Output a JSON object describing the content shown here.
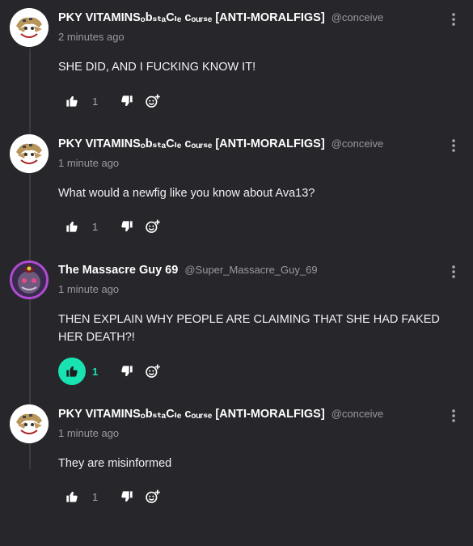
{
  "comments": [
    {
      "username": "PKY VITAMINSₒbₛₜₐCₗₑ cₒᵤᵣₛₑ [ANTI-MORALFIGS]",
      "handle": "@conceive",
      "time": "2 minutes ago",
      "text": "SHE DID, AND I FUCKING KNOW IT!",
      "likes": "1",
      "liked": false
    },
    {
      "username": "PKY VITAMINSₒbₛₜₐCₗₑ cₒᵤᵣₛₑ [ANTI-MORALFIGS]",
      "handle": "@conceive",
      "time": "1 minute ago",
      "text": "What would a newfig like you know about Ava13?",
      "likes": "1",
      "liked": false
    },
    {
      "username": "The Massacre Guy 69",
      "handle": "@Super_Massacre_Guy_69",
      "time": "1 minute ago",
      "text": "THEN EXPLAIN WHY PEOPLE ARE CLAIMING THAT SHE HAD FAKED HER DEATH?!",
      "likes": "1",
      "liked": true
    },
    {
      "username": "PKY VITAMINSₒbₛₜₐCₗₑ cₒᵤᵣₛₑ [ANTI-MORALFIGS]",
      "handle": "@conceive",
      "time": "1 minute ago",
      "text": "They are misinformed",
      "likes": "1",
      "liked": false
    }
  ],
  "icons": {
    "like": "thumbs-up-icon",
    "dislike": "thumbs-down-icon",
    "react": "add-reaction-icon",
    "menu": "more-vertical-icon"
  },
  "colors": {
    "background": "#27262b",
    "accent": "#19e3b1",
    "muted": "#9a99a0"
  }
}
